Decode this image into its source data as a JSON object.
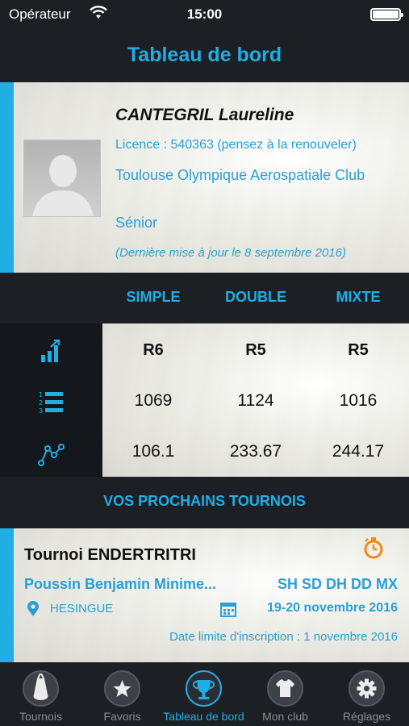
{
  "status_bar": {
    "carrier": "Opérateur",
    "time": "15:00"
  },
  "header": {
    "title": "Tableau de bord"
  },
  "profile": {
    "name": "CANTEGRIL Laureline",
    "licence": "Licence : 540363 (pensez à la renouveler)",
    "club": "Toulouse Olympique Aerospatiale Club",
    "category": "Sénior",
    "last_update": "(Dernière mise à jour le 8 septembre 2016)"
  },
  "stats": {
    "columns": [
      "SIMPLE",
      "DOUBLE",
      "MIXTE"
    ],
    "rows": [
      {
        "icon": "ranking-bars-icon",
        "values": [
          "R6",
          "R5",
          "R5"
        ]
      },
      {
        "icon": "numbered-list-icon",
        "values": [
          "1069",
          "1124",
          "1016"
        ]
      },
      {
        "icon": "points-graph-icon",
        "values": [
          "106.1",
          "233.67",
          "244.17"
        ]
      }
    ]
  },
  "upcoming": {
    "heading": "VOS PROCHAINS TOURNOIS",
    "tournament": {
      "name": "Tournoi ENDERTRITRI",
      "categories": "Poussin Benjamin Minime...",
      "disciplines": "SH SD DH DD MX",
      "location": "HESINGUE",
      "dates": "19-20 novembre 2016",
      "deadline": "Date limite d'inscription : 1 novembre 2016"
    }
  },
  "tabbar": {
    "items": [
      {
        "label": "Tournois",
        "icon": "shuttlecock-icon",
        "active": false
      },
      {
        "label": "Favoris",
        "icon": "star-icon",
        "active": false
      },
      {
        "label": "Tableau de bord",
        "icon": "trophy-icon",
        "active": true
      },
      {
        "label": "Mon club",
        "icon": "shirt-icon",
        "active": false
      },
      {
        "label": "Réglages",
        "icon": "gear-icon",
        "active": false
      }
    ]
  },
  "colors": {
    "accent": "#21aee5",
    "dark": "#1c1f24",
    "text_blue": "#2a9fd4"
  }
}
